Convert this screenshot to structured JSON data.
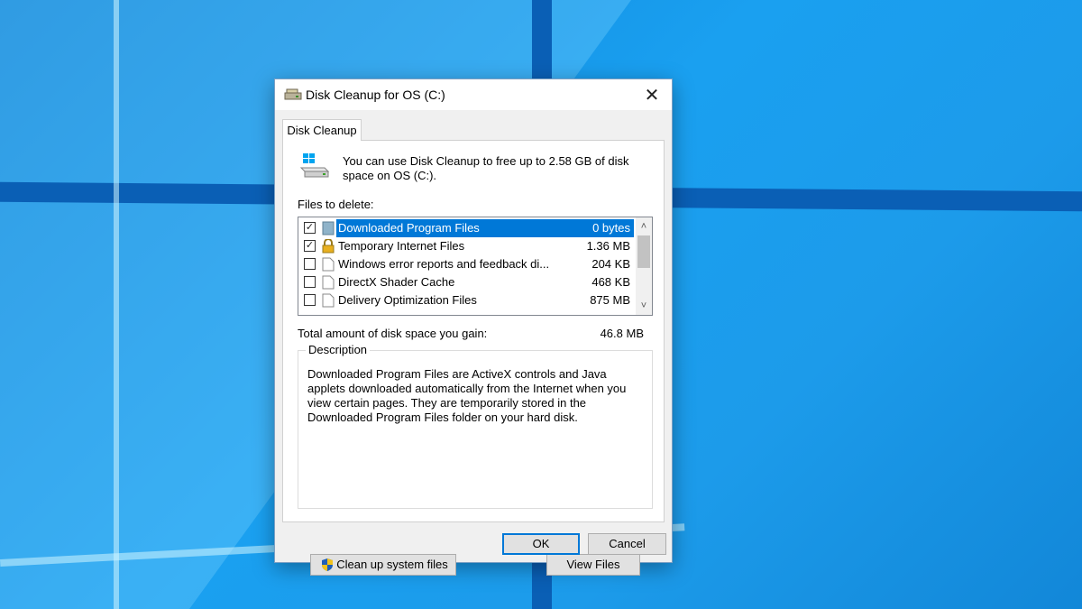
{
  "window": {
    "title": "Disk Cleanup for OS (C:)",
    "close_glyph": "✕"
  },
  "tab": {
    "label": "Disk Cleanup"
  },
  "intro": {
    "text": "You can use Disk Cleanup to free up to 2.58 GB of disk space on OS (C:)."
  },
  "files": {
    "label": "Files to delete:",
    "items": [
      {
        "name": "Downloaded Program Files",
        "size": "0 bytes",
        "checked": true,
        "selected": true,
        "icon": "folder-icon"
      },
      {
        "name": "Temporary Internet Files",
        "size": "1.36 MB",
        "checked": true,
        "selected": false,
        "icon": "lock-icon"
      },
      {
        "name": "Windows error reports and feedback di...",
        "size": "204 KB",
        "checked": false,
        "selected": false,
        "icon": "file-icon"
      },
      {
        "name": "DirectX Shader Cache",
        "size": "468 KB",
        "checked": false,
        "selected": false,
        "icon": "file-icon"
      },
      {
        "name": "Delivery Optimization Files",
        "size": "875 MB",
        "checked": false,
        "selected": false,
        "icon": "file-icon"
      }
    ]
  },
  "total": {
    "label": "Total amount of disk space you gain:",
    "value": "46.8 MB"
  },
  "description": {
    "title": "Description",
    "text": "Downloaded Program Files are ActiveX controls and Java applets downloaded automatically from the Internet when you view certain pages. They are temporarily stored in the Downloaded Program Files folder on your hard disk."
  },
  "buttons": {
    "cleanup_system": "Clean up system files",
    "view_files": "View Files",
    "ok": "OK",
    "cancel": "Cancel"
  },
  "colors": {
    "selection": "#0078d7",
    "desktop": "#1aa0f0"
  }
}
